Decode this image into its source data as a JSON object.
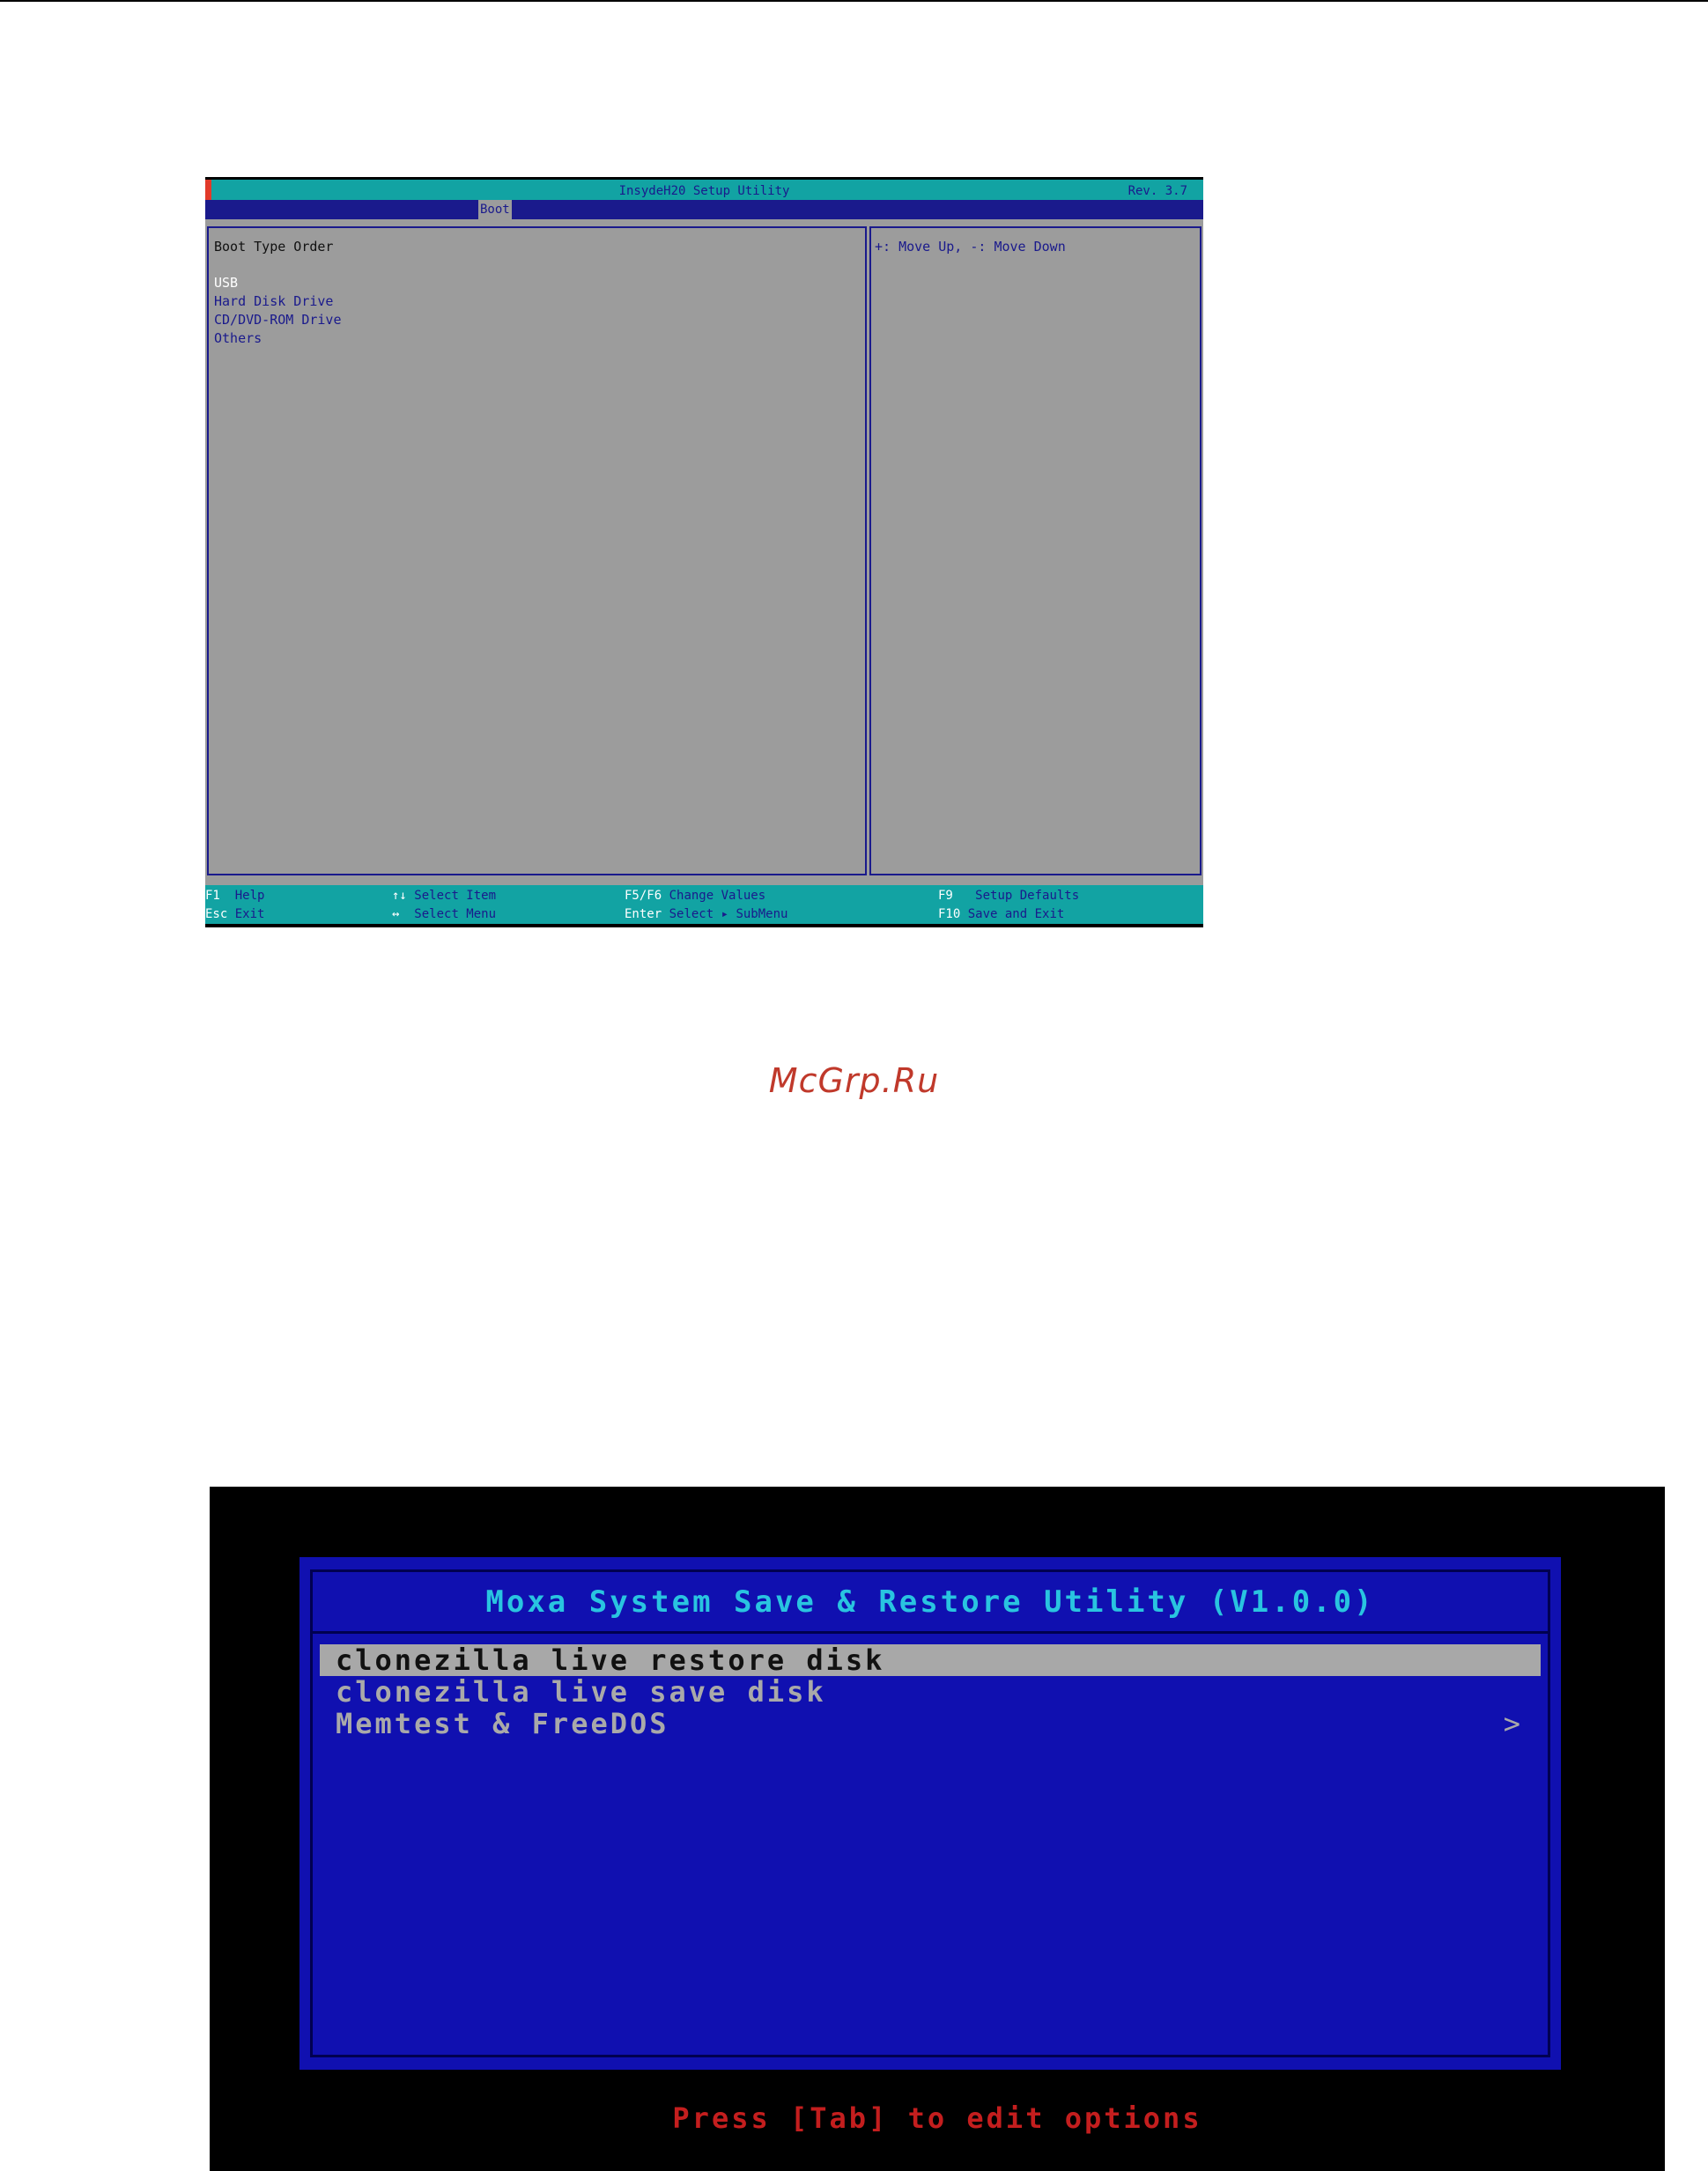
{
  "bios": {
    "title": "InsydeH20 Setup Utility",
    "revision": "Rev. 3.7",
    "active_tab": "Boot",
    "main": {
      "heading": "Boot Type Order",
      "items": [
        "USB",
        "Hard Disk Drive",
        "CD/DVD-ROM Drive",
        "Others"
      ]
    },
    "help_text": "+: Move Up, -: Move Down",
    "footer": [
      {
        "key": "F1",
        "desc": "Help"
      },
      {
        "key": "Esc",
        "desc": "Exit"
      },
      {
        "key": "↑↓",
        "desc": "Select Item"
      },
      {
        "key": "↔",
        "desc": "Select Menu"
      },
      {
        "key": "F5/F6",
        "desc": "Change Values"
      },
      {
        "key": "Enter",
        "desc": "Select ▸ SubMenu"
      },
      {
        "key": "F9",
        "desc": "Setup Defaults"
      },
      {
        "key": "F10",
        "desc": "Save and Exit"
      }
    ],
    "colors": {
      "background": "#9c9c9c",
      "bar": "#12a3a3",
      "navy": "#1a1a8c"
    }
  },
  "watermark": "McGrp.Ru",
  "boot_menu": {
    "title": "Moxa System Save & Restore Utility (V1.0.0)",
    "items": [
      {
        "label": "clonezilla live restore disk"
      },
      {
        "label": "clonezilla live save disk"
      },
      {
        "label": "Memtest & FreeDOS",
        "submenu_icon": "chevron-right-icon",
        "submenu_glyph": ">"
      }
    ],
    "hint": "Press [Tab] to edit options",
    "colors": {
      "frame": "#1010b0",
      "title": "#29c4e0",
      "hint": "#c41e1e"
    }
  }
}
